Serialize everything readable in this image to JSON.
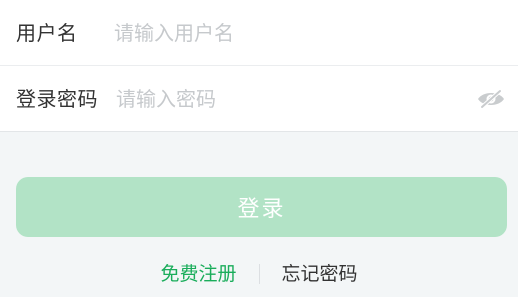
{
  "form": {
    "username": {
      "label": "用户名",
      "value": "",
      "placeholder": "请输入用户名"
    },
    "password": {
      "label": "登录密码",
      "value": "",
      "placeholder": "请输入密码",
      "toggle_icon": "eye-off-icon"
    }
  },
  "actions": {
    "login_label": "登录",
    "register_label": "免费注册",
    "forgot_label": "忘记密码"
  },
  "colors": {
    "primary": "#1aad5b",
    "login_button_disabled": "#b2e3c6",
    "background": "#f3f6f7",
    "placeholder": "#c6c9cc",
    "icon": "#c9ccce"
  }
}
